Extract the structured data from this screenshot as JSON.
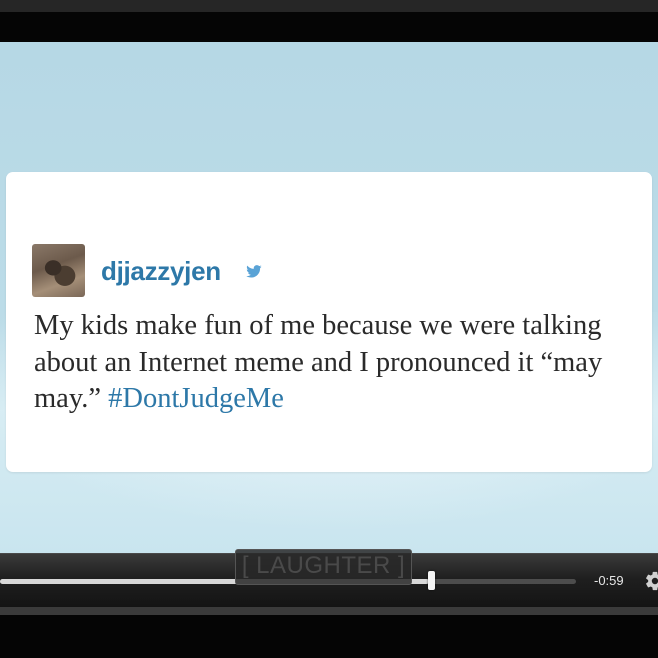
{
  "tweet": {
    "username": "djjazzyjen",
    "verified_icon": "twitter-bird-icon",
    "text": "My kids make fun of me because we were talking about an Internet meme and I pronounced it “may may.” ",
    "hashtag": "#DontJudgeMe",
    "link_color": "#2d78a8"
  },
  "player": {
    "caption": "[ LAUGHTER ]",
    "time_remaining": "-0:59",
    "progress": 0.745,
    "settings_icon": "gear-icon"
  },
  "colors": {
    "background_sky": "#b6d8e5",
    "card": "#ffffff",
    "controls": "#1f1f1f"
  }
}
